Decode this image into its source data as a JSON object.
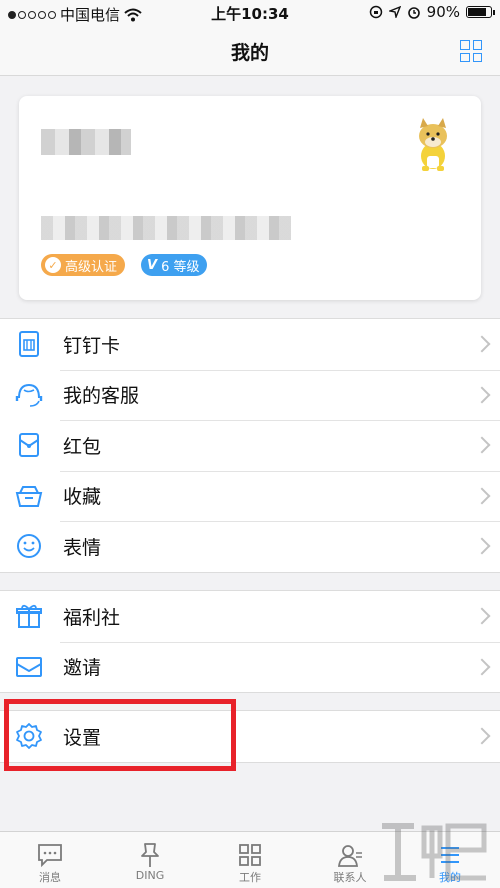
{
  "status_bar": {
    "carrier": "中国电信",
    "time": "上午10:34",
    "battery": "90%",
    "battery_level": 0.9
  },
  "header": {
    "title": "我的"
  },
  "profile": {
    "badges": {
      "certified": "高级认证",
      "level_prefix": "V",
      "level": "6 等级"
    }
  },
  "menu_group_1": [
    {
      "label": "钉钉卡"
    },
    {
      "label": "我的客服"
    },
    {
      "label": "红包"
    },
    {
      "label": "收藏"
    },
    {
      "label": "表情"
    }
  ],
  "menu_group_2": [
    {
      "label": "福利社"
    },
    {
      "label": "邀请"
    }
  ],
  "menu_group_3": [
    {
      "label": "设置"
    }
  ],
  "tabbar": [
    {
      "label": "消息"
    },
    {
      "label": "DING"
    },
    {
      "label": "工作"
    },
    {
      "label": "联系人"
    },
    {
      "label": "我的"
    }
  ],
  "colors": {
    "accent": "#3296fa",
    "highlight": "#e8222a",
    "cert_badge": "#f5a94b",
    "level_badge": "#3ea0f0"
  }
}
